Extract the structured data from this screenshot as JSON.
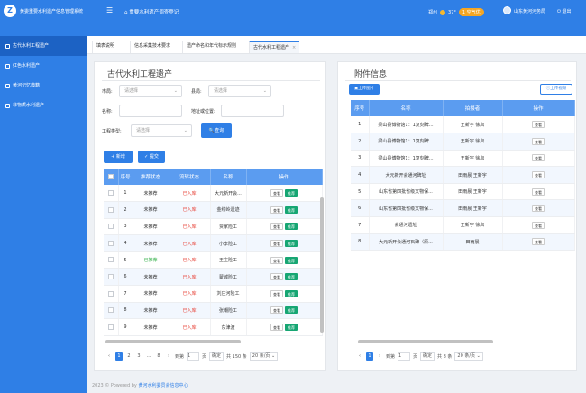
{
  "header": {
    "app_title": "黄委重要水利遗产信息管理系统",
    "home_title": "重要水利遗产调查登记",
    "city": "郑州",
    "temp": "37°",
    "aqi": "1 空气优",
    "org": "山东黄河河务局",
    "logout": "退出"
  },
  "sidebar": {
    "items": [
      {
        "label": "古代水利工程遗产"
      },
      {
        "label": "红色水利遗产"
      },
      {
        "label": "黄河记忆典籍"
      },
      {
        "label": "非物质水利遗产"
      }
    ]
  },
  "tabs": [
    {
      "label": "填表说明"
    },
    {
      "label": "信息采集技术要求"
    },
    {
      "label": "遗产命名和年代标示规则"
    },
    {
      "label": "古代水利工程遗产"
    }
  ],
  "left": {
    "title": "古代水利工程遗产",
    "city_label": "市局:",
    "county_label": "县局:",
    "name_label": "名称:",
    "address_label": "地址或位置:",
    "type_label": "工程类型:",
    "placeholder": "请选择",
    "search": "查询",
    "add": "+ 新增",
    "submit": "✓ 提交",
    "columns": [
      "序号",
      "推荐状态",
      "流转状态",
      "名称",
      "操作"
    ],
    "rows": [
      {
        "no": "1",
        "rec": "未推荐",
        "flow": "已入库",
        "name": "大元新开会..."
      },
      {
        "no": "2",
        "rec": "未推荐",
        "flow": "已入库",
        "name": "金缕岭遗迹"
      },
      {
        "no": "3",
        "rec": "未推荐",
        "flow": "已入库",
        "name": "贾家险工"
      },
      {
        "no": "4",
        "rec": "未推荐",
        "flow": "已入库",
        "name": "小李险工"
      },
      {
        "no": "5",
        "rec": "已推荐",
        "flow": "已入库",
        "name": "王庄险工"
      },
      {
        "no": "6",
        "rec": "未推荐",
        "flow": "已入库",
        "name": "蒙城险工"
      },
      {
        "no": "7",
        "rec": "未推荐",
        "flow": "已入库",
        "name": "刘庄河险工"
      },
      {
        "no": "8",
        "rec": "未推荐",
        "flow": "已入库",
        "name": "张潮险工"
      },
      {
        "no": "9",
        "rec": "未推荐",
        "flow": "已入库",
        "name": "东津渡"
      }
    ],
    "view": "查看",
    "recommend": "推荐",
    "pager": {
      "pages": [
        "1",
        "2",
        "3",
        "...",
        "8"
      ],
      "goto": "到第",
      "page_val": "1",
      "page_unit": "页",
      "confirm": "确定",
      "total": "共 150 条",
      "size": "20 条/页"
    }
  },
  "right": {
    "title": "附件信息",
    "upload_img": "上传图片",
    "upload_video": "上传视频",
    "columns": [
      "序号",
      "名称",
      "拍摄者",
      "操作"
    ],
    "rows": [
      {
        "no": "1",
        "name": "梁山县博物馆1：1复刻碑...",
        "author": "王新宇 徐启"
      },
      {
        "no": "2",
        "name": "梁山县博物馆1：1复刻碑...",
        "author": "王新宇 徐启"
      },
      {
        "no": "3",
        "name": "梁山县博物馆1：1复刻碑...",
        "author": "王新宇 徐启"
      },
      {
        "no": "4",
        "name": "大元新开会通河碑址",
        "author": "田雨晨 王新宇"
      },
      {
        "no": "5",
        "name": "山东省第四批省级文物保...",
        "author": "田雨晨 王新宇"
      },
      {
        "no": "6",
        "name": "山东省第四批省级文物保...",
        "author": "田雨晨 王新宇"
      },
      {
        "no": "7",
        "name": "会通河遗址",
        "author": "王新宇 徐启"
      },
      {
        "no": "8",
        "name": "大元新开会通河石碑（原...",
        "author": "田雨晨"
      }
    ],
    "view": "查看",
    "pager": {
      "page": "1",
      "goto": "到第",
      "page_val": "1",
      "page_unit": "页",
      "confirm": "确定",
      "total": "共 8 条",
      "size": "20 条/页"
    }
  },
  "footer": {
    "prefix": "2023 © Powered by",
    "link": "黄河水利委员会信息中心"
  }
}
